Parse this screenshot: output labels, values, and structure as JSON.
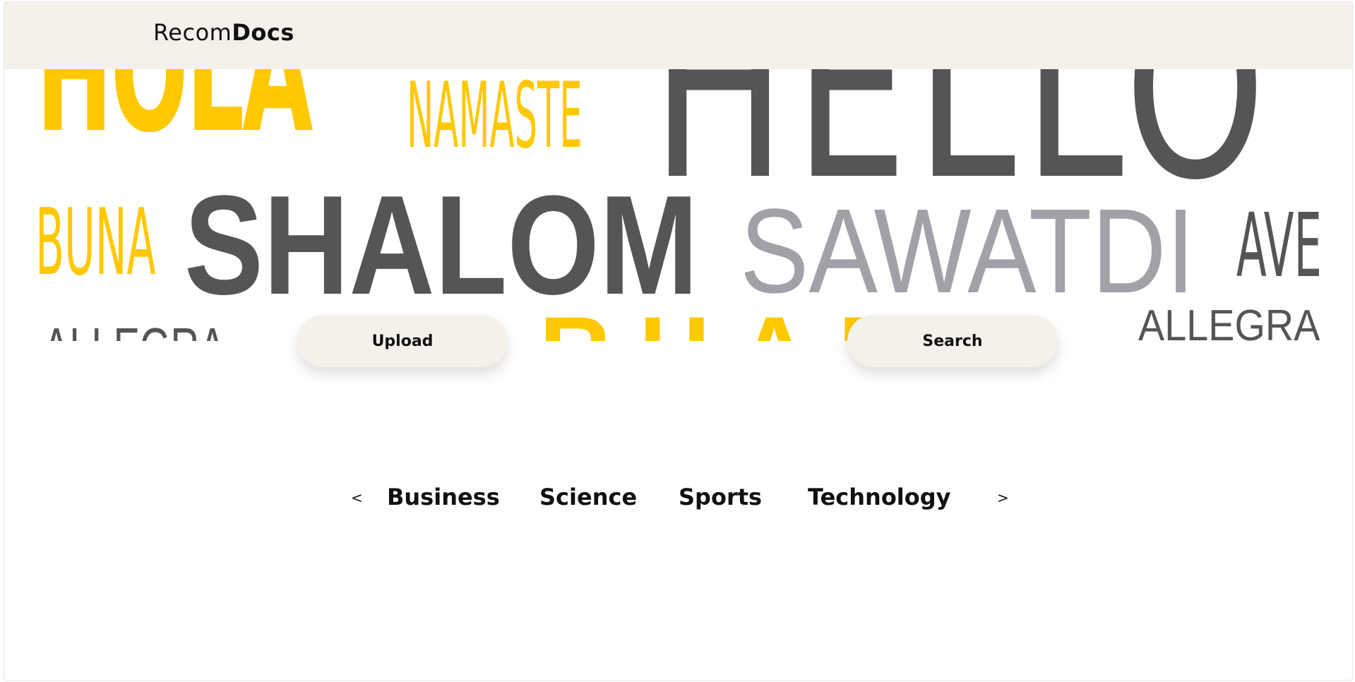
{
  "brand": {
    "prefix": "Recom",
    "suffix": "Docs"
  },
  "banner": {
    "words": {
      "hola": "HOLA",
      "namaste": "NAMASTE",
      "hello": "HELLO",
      "buna": "BUNA",
      "shalom": "SHALOM",
      "sawatdi": "SAWATDI",
      "ave": "AVE",
      "allegra_faint": "ALLEGRA",
      "yellow_big": "MARHABA",
      "allegra": "ALLEGRA"
    },
    "colors": {
      "yellow": "#ffc800",
      "dark_gray": "#555555",
      "light_gray": "#a1a1a8"
    }
  },
  "actions": {
    "upload_label": "Upload",
    "search_label": "Search"
  },
  "categories": {
    "prev_label": "<",
    "next_label": ">",
    "items": [
      {
        "label": "Business"
      },
      {
        "label": "Science"
      },
      {
        "label": "Sports"
      },
      {
        "label": "Technology"
      }
    ]
  },
  "theme": {
    "navbar_bg": "#f4f1ea",
    "button_bg": "#f4f1ea"
  }
}
